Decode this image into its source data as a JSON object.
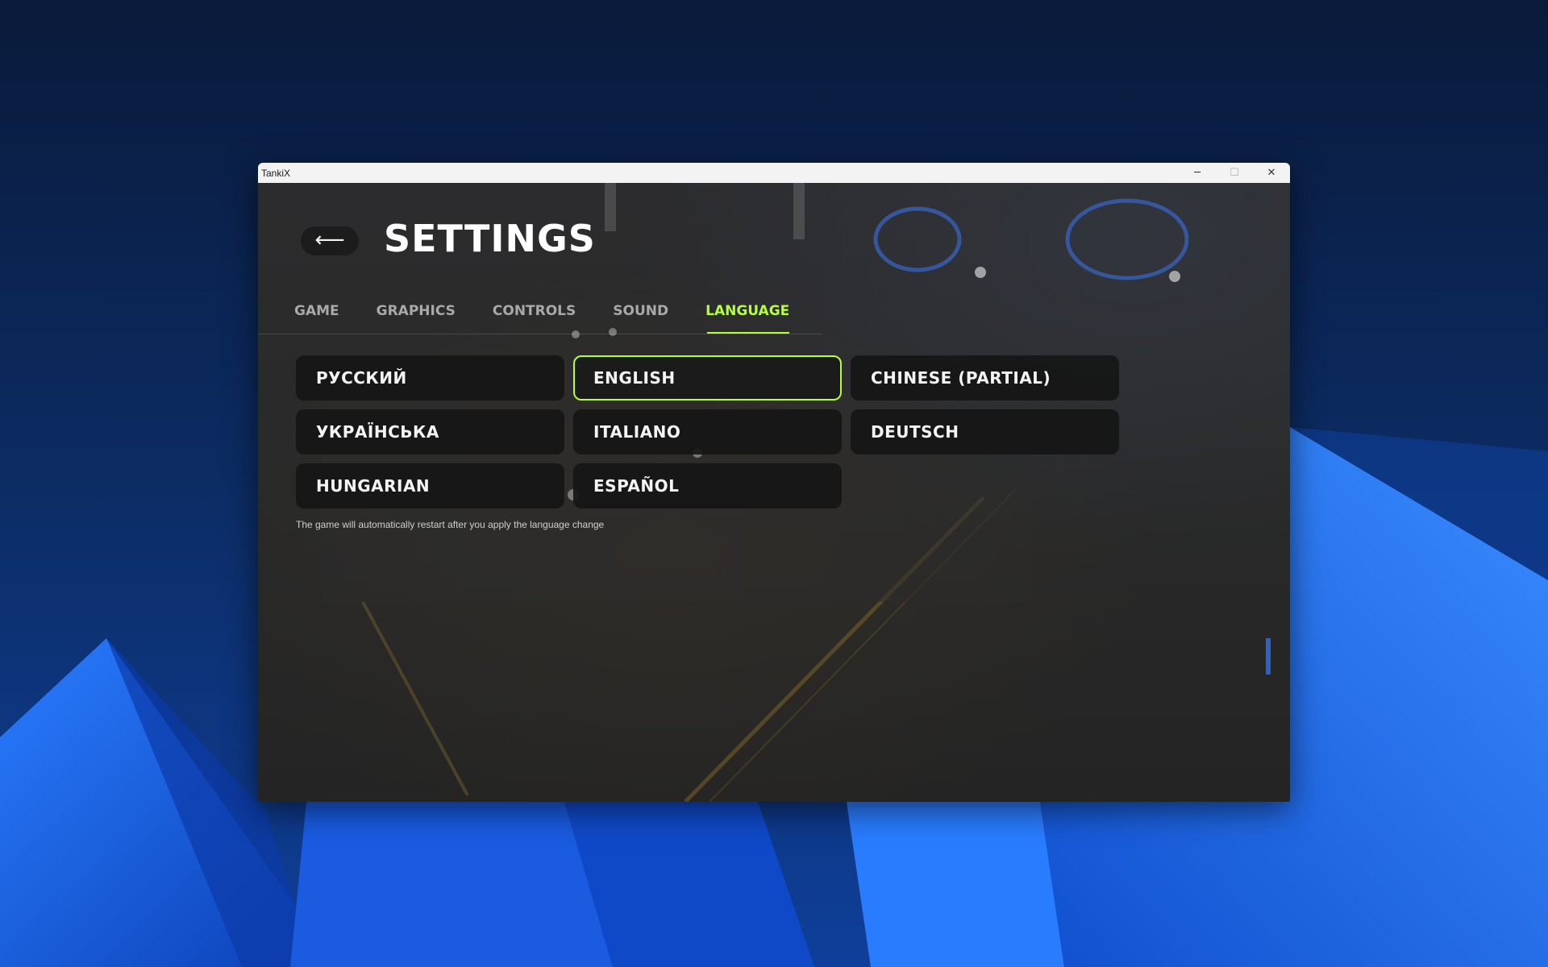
{
  "window": {
    "title": "TankiX",
    "minimize_label": "─",
    "maximize_label": "☐",
    "close_label": "✕"
  },
  "header": {
    "back_label": "⟵",
    "title": "SETTINGS"
  },
  "tabs": [
    {
      "label": "GAME",
      "active": false
    },
    {
      "label": "GRAPHICS",
      "active": false
    },
    {
      "label": "CONTROLS",
      "active": false
    },
    {
      "label": "SOUND",
      "active": false
    },
    {
      "label": "LANGUAGE",
      "active": true
    }
  ],
  "languages": [
    {
      "label": "РУССКИЙ",
      "selected": false
    },
    {
      "label": "ENGLISH",
      "selected": true
    },
    {
      "label": "CHINESE (PARTIAL)",
      "selected": false
    },
    {
      "label": "УКРАЇНСЬКА",
      "selected": false
    },
    {
      "label": "ITALIANO",
      "selected": false
    },
    {
      "label": "DEUTSCH",
      "selected": false
    },
    {
      "label": "HUNGARIAN",
      "selected": false
    },
    {
      "label": "ESPAÑOL",
      "selected": false
    }
  ],
  "note": "The game will automatically restart after you apply the language change",
  "colors": {
    "accent": "#b5ff3a",
    "button_bg": "#161616",
    "tab_inactive": "#a9a9a9"
  }
}
